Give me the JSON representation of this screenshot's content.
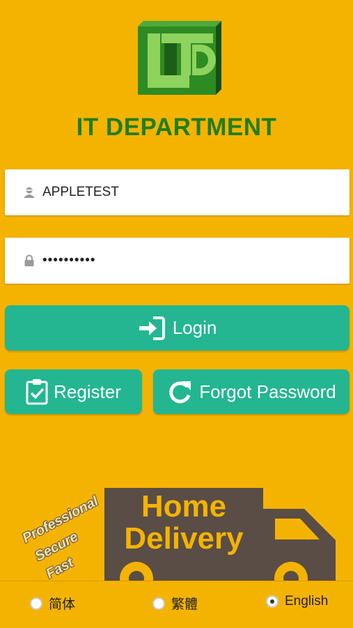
{
  "brand": {
    "name": "IT DEPARTMENT"
  },
  "login_form": {
    "username_value": "APPLETEST",
    "password_value": "••••••••••",
    "login_label": "Login",
    "register_label": "Register",
    "forgot_label": "Forgot Password"
  },
  "promo": {
    "home_delivery_line1": "Home",
    "home_delivery_line2": "Delivery",
    "slogans": [
      "Professional",
      "Secure",
      "Fast"
    ]
  },
  "languages": [
    {
      "label": "简体",
      "selected": false
    },
    {
      "label": "繁體",
      "selected": false
    },
    {
      "label": "English",
      "selected": true
    }
  ],
  "colors": {
    "background": "#f5b301",
    "brand_green": "#207e1c",
    "button_teal": "#23b690"
  }
}
